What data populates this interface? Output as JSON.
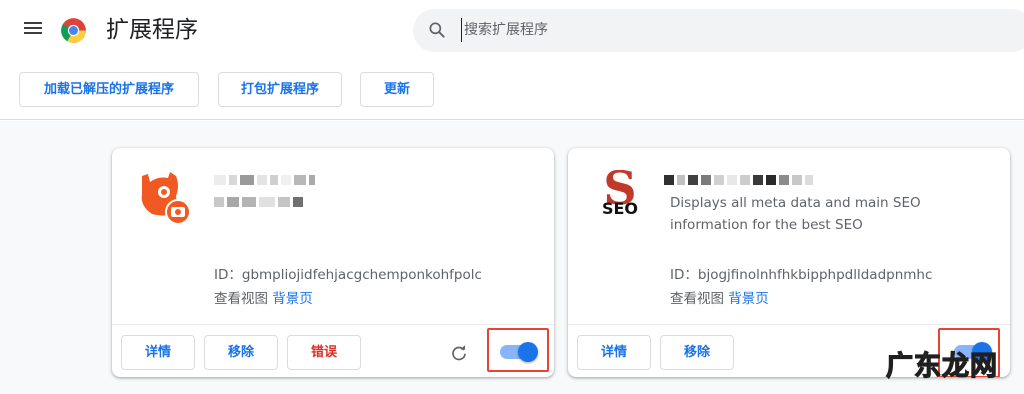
{
  "app": {
    "title": "扩展程序",
    "search_placeholder": "搜索扩展程序"
  },
  "toolbar": {
    "load_unpacked": "加载已解压的扩展程序",
    "pack": "打包扩展程序",
    "update": "更新"
  },
  "extensions": [
    {
      "icon": "orange-camera-extension-icon",
      "description": "",
      "id_label": "ID：gbmpliojidfehjacgchemponkohfpolc",
      "views_label": "查看视图",
      "views_link": "背景页",
      "buttons": {
        "details": "详情",
        "remove": "移除",
        "errors": "错误"
      },
      "enabled": true
    },
    {
      "icon": "seo-logo-icon",
      "logo_text": "SEO",
      "description": "Displays all meta data and main SEO information for the best SEO",
      "id_label": "ID：bjogjfinolnhfhkbipphpdlldadpnmhc",
      "views_label": "查看视图",
      "views_link": "背景页",
      "buttons": {
        "details": "详情",
        "remove": "移除"
      },
      "enabled": true
    }
  ],
  "watermark": "广东龙网",
  "colors": {
    "accent": "#1a73e8",
    "toggle_track": "#8ab4f8",
    "error": "#d93025",
    "highlight": "#ea4335",
    "icon_orange": "#f05a22"
  }
}
